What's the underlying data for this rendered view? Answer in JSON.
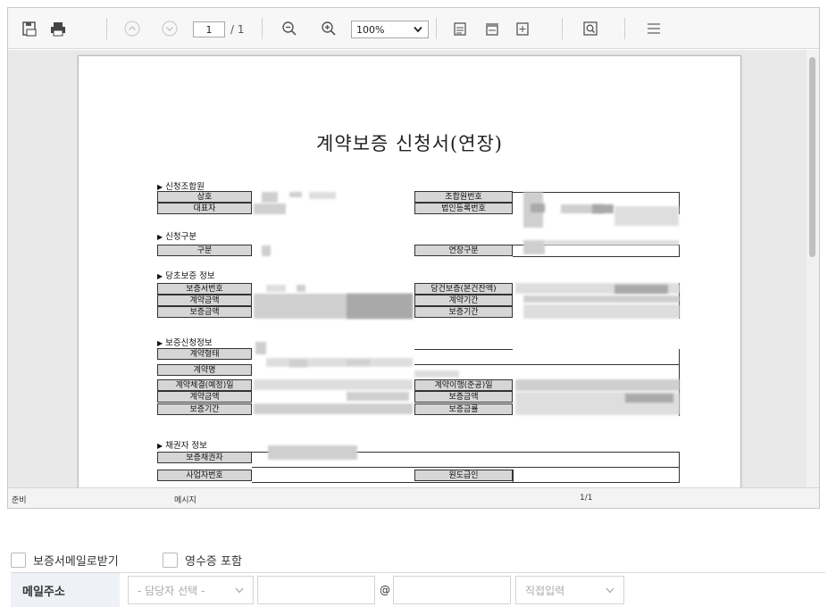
{
  "toolbar": {
    "page_current": "1",
    "page_total": "/ 1",
    "zoom": "100%",
    "zoom_options": [
      "100%"
    ]
  },
  "document": {
    "title": "계약보증 신청서(연장)",
    "sections": {
      "applicant": "신청조합원",
      "type": "신청구분",
      "original": "당초보증 정보",
      "request": "보증신청정보",
      "creditor": "채권자 정보"
    },
    "labels": {
      "trade_name": "상호",
      "representative": "대표자",
      "member_no": "조합원번호",
      "corp_reg_no": "법인등록번호",
      "division": "구분",
      "ext_division": "연장구분",
      "cert_no": "보증서번호",
      "contract_amount": "계약금액",
      "guarantee_amount": "보증금액",
      "guarantee_balance": "당건보증(본건잔액)",
      "contract_period": "계약기간",
      "guarantee_period": "보증기간",
      "contract_form": "계약형태",
      "contract_name": "계약명",
      "contract_date": "계약체결(예정)일",
      "req_contract_amount": "계약금액",
      "req_guarantee_period": "보증기간",
      "performance_date": "계약이행(준공)일",
      "req_guarantee_amount": "보증금액",
      "guarantee_rate": "보증금률",
      "creditor_name": "보증채권자",
      "business_no": "사업자번호",
      "subcontractor": "원도급인"
    }
  },
  "statusbar": {
    "state": "준비",
    "message": "메시지",
    "pages": "1/1"
  },
  "form": {
    "email_cert_label": "보증서메일로받기",
    "receipt_label": "영수증 포함",
    "email_label": "메일주소",
    "manager_select": "- 담당자 선택 -",
    "at": "@",
    "domain_select": "직접입력"
  },
  "colors": {
    "toolbar_bg": "#f7f7f7",
    "doc_bg": "#e9e9e9",
    "label_fill": "#d6d6d6",
    "form_head_bg": "#eef1f5"
  }
}
